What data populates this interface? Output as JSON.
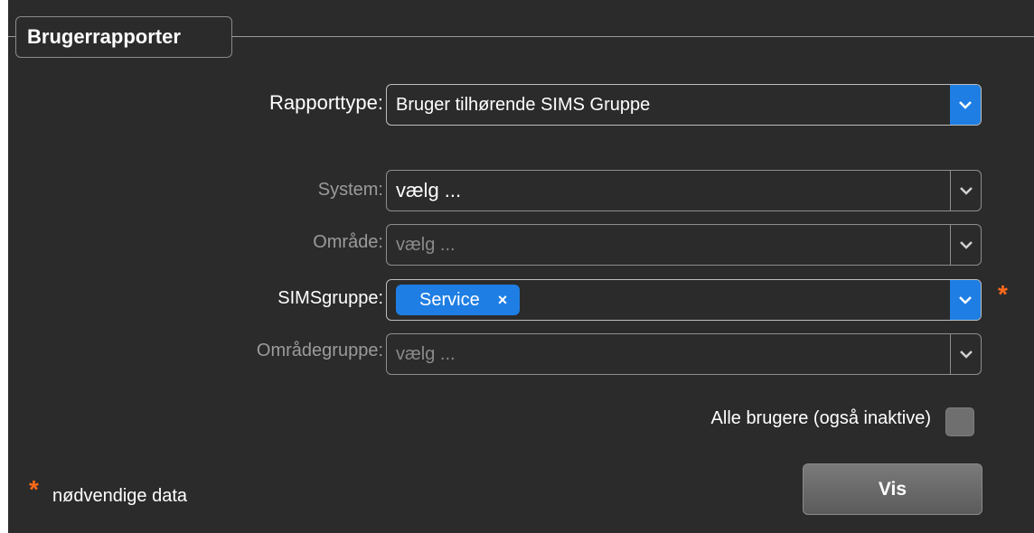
{
  "header": {
    "title": "Brugerrapporter"
  },
  "report_type": {
    "label": "Rapporttype:",
    "value": "Bruger tilhørende SIMS Gruppe"
  },
  "system": {
    "label": "System:",
    "value": "vælg ..."
  },
  "area": {
    "label": "Område:",
    "placeholder": "vælg ..."
  },
  "sims_group": {
    "label": "SIMSgruppe:",
    "selected_tag": "Service",
    "tag_remove": "×",
    "required_marker": "*"
  },
  "area_group": {
    "label": "Områdegruppe:",
    "placeholder": "vælg ..."
  },
  "all_users": {
    "label": "Alle brugere (også inaktive)",
    "checked": false
  },
  "submit": {
    "label": "Vis"
  },
  "legend": {
    "marker": "*",
    "text": "nødvendige data"
  },
  "colors": {
    "background": "#2b2b2b",
    "accent": "#1e7ee3",
    "required": "#ff6a1a"
  }
}
